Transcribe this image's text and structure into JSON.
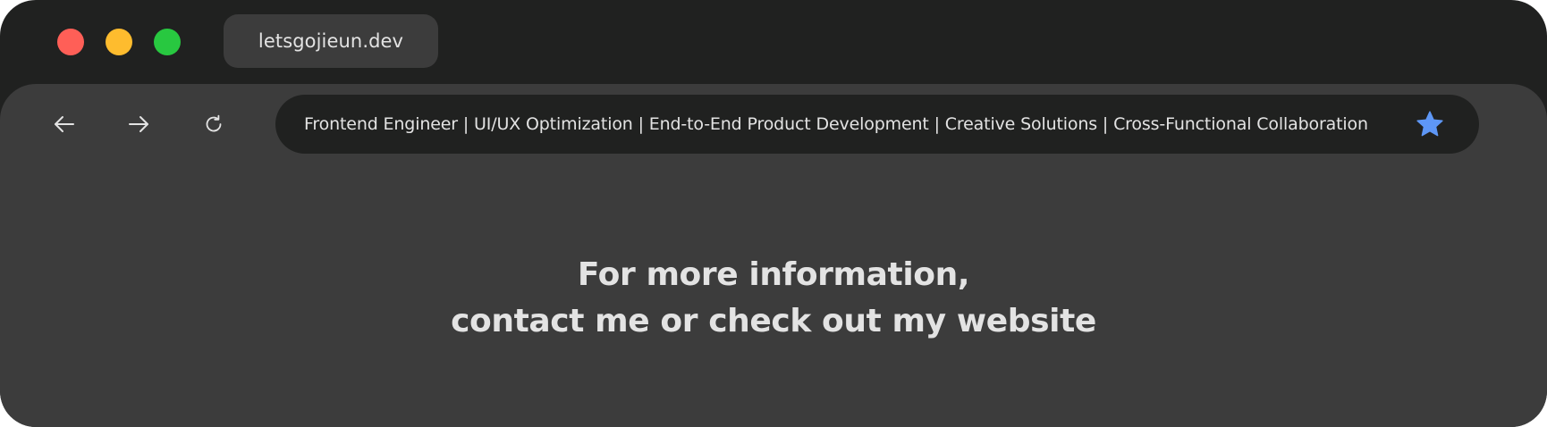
{
  "window": {
    "controls": {
      "close_color": "#ff5f57",
      "minimize_color": "#febc2e",
      "maximize_color": "#28c840"
    }
  },
  "tab": {
    "label": "letsgojieun.dev"
  },
  "toolbar": {
    "back_icon": "arrow-left-icon",
    "forward_icon": "arrow-right-icon",
    "reload_icon": "reload-icon"
  },
  "address_bar": {
    "text": "Frontend Engineer | UI/UX Optimization | End-to-End Product Development | Creative Solutions | Cross-Functional Collaboration",
    "bookmark_icon": "star-icon",
    "bookmark_color": "#5e97f6"
  },
  "content": {
    "line1": "For more information,",
    "line2": "contact me or check out my website"
  }
}
